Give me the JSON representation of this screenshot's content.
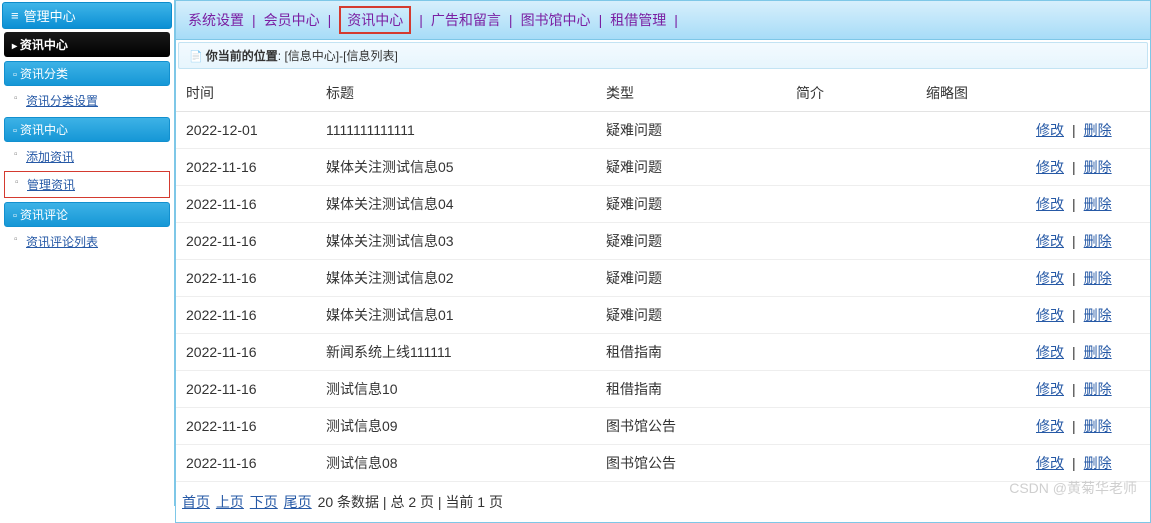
{
  "side_top": "管理中心",
  "side_panel": "资讯中心",
  "side_groups": [
    {
      "head": "资讯分类",
      "items": [
        {
          "label": "资讯分类设置",
          "boxed": false
        }
      ]
    },
    {
      "head": "资讯中心",
      "items": [
        {
          "label": "添加资讯",
          "boxed": false
        },
        {
          "label": "管理资讯",
          "boxed": true
        }
      ]
    },
    {
      "head": "资讯评论",
      "items": [
        {
          "label": "资讯评论列表",
          "boxed": false
        }
      ]
    }
  ],
  "topnav": {
    "items": [
      "系统设置",
      "会员中心",
      "资讯中心",
      "广告和留言",
      "图书馆中心",
      "租借管理"
    ],
    "highlight_index": 2
  },
  "breadcrumb": {
    "prefix": "你当前的位置",
    "path1": "[信息中心]",
    "path2": "[信息列表]"
  },
  "table": {
    "headers": [
      "时间",
      "标题",
      "类型",
      "简介",
      "缩略图",
      ""
    ],
    "rows": [
      {
        "time": "2022-12-01",
        "title": "1111111111111",
        "type": "疑难问题"
      },
      {
        "time": "2022-11-16",
        "title": "媒体关注测试信息05",
        "type": "疑难问题"
      },
      {
        "time": "2022-11-16",
        "title": "媒体关注测试信息04",
        "type": "疑难问题"
      },
      {
        "time": "2022-11-16",
        "title": "媒体关注测试信息03",
        "type": "疑难问题"
      },
      {
        "time": "2022-11-16",
        "title": "媒体关注测试信息02",
        "type": "疑难问题"
      },
      {
        "time": "2022-11-16",
        "title": "媒体关注测试信息01",
        "type": "疑难问题"
      },
      {
        "time": "2022-11-16",
        "title": "新闻系统上线111111",
        "type": "租借指南"
      },
      {
        "time": "2022-11-16",
        "title": "测试信息10",
        "type": "租借指南"
      },
      {
        "time": "2022-11-16",
        "title": "测试信息09",
        "type": "图书馆公告"
      },
      {
        "time": "2022-11-16",
        "title": "测试信息08",
        "type": "图书馆公告"
      }
    ],
    "action_edit": "修改",
    "action_delete": "删除"
  },
  "pager": {
    "first": "首页",
    "prev": "上页",
    "next": "下页",
    "last": "尾页",
    "text": "20 条数据 | 总 2 页 | 当前 1 页"
  },
  "watermark": "CSDN @黄菊华老师"
}
